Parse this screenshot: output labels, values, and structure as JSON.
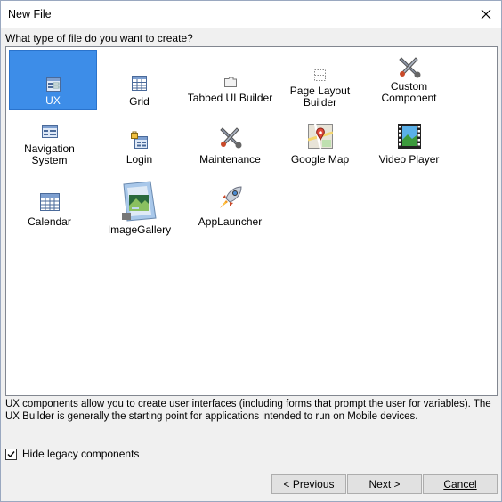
{
  "window": {
    "title": "New File"
  },
  "prompt": "What type of file do you want to create?",
  "items": [
    {
      "label": "UX",
      "icon": "ux-form-icon",
      "selected": true
    },
    {
      "label": "Grid",
      "icon": "grid-icon"
    },
    {
      "label": "Tabbed UI Builder",
      "icon": "folder-tab-icon"
    },
    {
      "label_lines": [
        "Page Layout",
        "Builder"
      ],
      "icon": "page-layout-icon"
    },
    {
      "label_lines": [
        "Custom",
        "Component"
      ],
      "icon": "wrench-screwdriver-icon"
    },
    {
      "label_lines": [
        "Navigation",
        "System"
      ],
      "icon": "navigation-form-icon"
    },
    {
      "label": "Login",
      "icon": "login-icon"
    },
    {
      "label": "Maintenance",
      "icon": "wrench-screwdriver-icon"
    },
    {
      "label": "Google Map",
      "icon": "map-icon"
    },
    {
      "label": "Video Player",
      "icon": "film-icon"
    },
    {
      "label": "Calendar",
      "icon": "calendar-icon"
    },
    {
      "label": "ImageGallery",
      "icon": "photo-gallery-icon"
    },
    {
      "label": "AppLauncher",
      "icon": "rocket-icon"
    }
  ],
  "description": "UX components allow you to create user interfaces (including forms that prompt the user for variables). The UX Builder is generally the starting point for applications intended to run on Mobile devices.",
  "hide_legacy": {
    "label": "Hide legacy components",
    "checked": true
  },
  "buttons": {
    "previous": "< Previous",
    "next": "Next >",
    "cancel": "Cancel"
  },
  "colors": {
    "selection": "#3d8de8",
    "window_bg": "#f0f0f0"
  }
}
